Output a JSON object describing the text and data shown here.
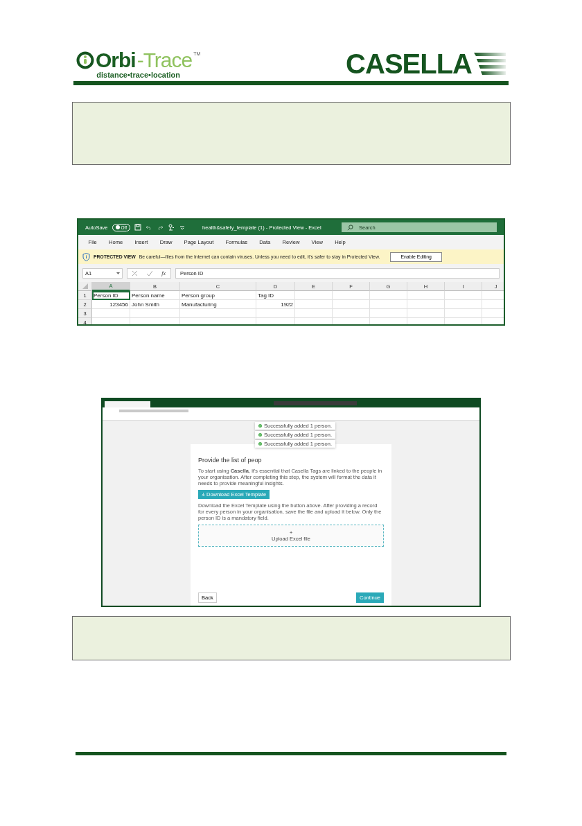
{
  "header": {
    "logo_left": {
      "name": "Orbi",
      "name_suffix": "-Trace",
      "trademark": "TM",
      "tagline": "distance•trace•location"
    },
    "logo_right": {
      "name": "CASELLA"
    }
  },
  "excel": {
    "autosave": {
      "label": "AutoSave",
      "toggle_text": "Off",
      "on": false
    },
    "title": "health&safety_template (1)  -  Protected View  -  Excel",
    "search": {
      "placeholder": "Search"
    },
    "menu": [
      "File",
      "Home",
      "Insert",
      "Draw",
      "Page Layout",
      "Formulas",
      "Data",
      "Review",
      "View",
      "Help"
    ],
    "protected_bar": {
      "label": "PROTECTED VIEW",
      "message": "Be careful—files from the Internet can contain viruses. Unless you need to edit, it's safer to stay in Protected View.",
      "button": "Enable Editing"
    },
    "formula_bar": {
      "name_box": "A1",
      "fx": "fx",
      "value": "Person ID"
    },
    "columns": [
      {
        "label": "A",
        "selected": true
      },
      {
        "label": "B",
        "selected": false
      },
      {
        "label": "C",
        "selected": false
      },
      {
        "label": "D",
        "selected": false
      },
      {
        "label": "E",
        "selected": false
      },
      {
        "label": "F",
        "selected": false
      },
      {
        "label": "G",
        "selected": false
      },
      {
        "label": "H",
        "selected": false
      },
      {
        "label": "I",
        "selected": false
      },
      {
        "label": "J",
        "selected": false
      }
    ],
    "rows": [
      {
        "label": "1",
        "cells": [
          {
            "text": "Person ID",
            "kind": "text",
            "selected": true
          },
          {
            "text": "Person name",
            "kind": "text",
            "selected": false
          },
          {
            "text": "Person group",
            "kind": "text",
            "selected": false
          },
          {
            "text": "Tag ID",
            "kind": "text",
            "selected": false
          }
        ]
      },
      {
        "label": "2",
        "cells": [
          {
            "text": "123456",
            "kind": "number",
            "selected": false
          },
          {
            "text": "John Smith",
            "kind": "text",
            "selected": false
          },
          {
            "text": "Manufacturing",
            "kind": "text",
            "selected": false
          },
          {
            "text": "1922",
            "kind": "number",
            "selected": false
          }
        ]
      },
      {
        "label": "3"
      },
      {
        "label": "4"
      }
    ]
  },
  "browser": {
    "toasts": [
      "Successfully added 1 person.",
      "Successfully added 1 person.",
      "Successfully added 1 person."
    ],
    "card": {
      "title": "Provide the list of peop",
      "intro": "To start using **Casella**, it's essential that Casella Tags are linked to the people in your organisation. After completing this step, the system will format the data it needs to provide meaningful insights.",
      "download_button": "Download Excel Template",
      "instructions": "Download the Excel Template using the button above. After providing a record for every person in your organisation, save the file and upload it below. Only the person ID is a mandatory field.",
      "upload_plus": "+",
      "upload_label": "Upload Excel file",
      "back_button": "Back",
      "continue_button": "Continue"
    }
  }
}
